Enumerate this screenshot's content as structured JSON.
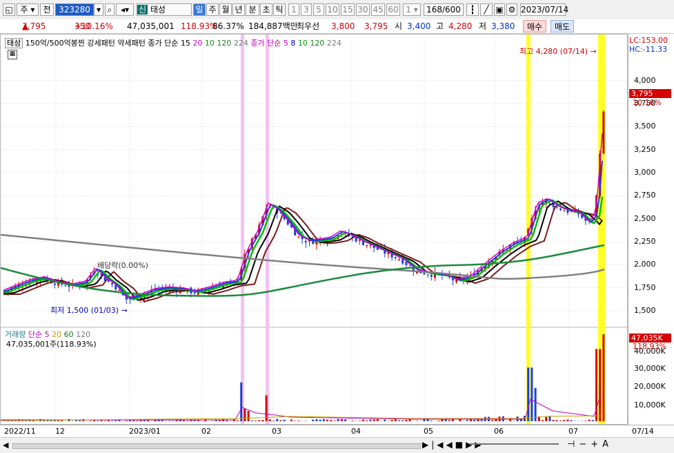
{
  "toolbar": {
    "market": "주",
    "prev_label": "전",
    "code": "323280",
    "stock_name": "태성",
    "stock_badge": "신",
    "periods": [
      "일",
      "주",
      "월",
      "년",
      "분",
      "초",
      "틱"
    ],
    "selected_period": "일",
    "intervals": [
      "1",
      "3",
      "5",
      "10",
      "15",
      "30",
      "45",
      "60"
    ],
    "interval_input": "1",
    "count": "168",
    "count_total": "/600",
    "date": "2023/07/14"
  },
  "quote": {
    "price": "3,795",
    "change_arrow": "▲",
    "change": "350",
    "change_pct": "+10.16%",
    "volume": "47,035,001",
    "vol_ratio": "118.93%",
    "turnover": "86.37%",
    "amount": "184,887백만",
    "best_label": "최우선",
    "ask": "3,800",
    "bid": "3,795",
    "open_label": "시",
    "open": "3,400",
    "high_label": "고",
    "high": "4,280",
    "low_label": "저",
    "low": "3,380",
    "buy": "매수",
    "sell": "매도"
  },
  "chart_legend": {
    "name": "태성",
    "signals": "150억/500억봉찐  강세패턴  약세패턴",
    "ma_close_label": "종가 단순 15",
    "ma_close_periods": [
      "20",
      "10",
      "120",
      "224"
    ],
    "ma2_label": "종가 단순 5",
    "ma2_periods": [
      "8",
      "10",
      "120",
      "224"
    ]
  },
  "annotations": {
    "high_note": "최고 4,280 (07/14)",
    "low_note": "최저 1,500 (01/03)",
    "dividend": "배당락(0.00%)"
  },
  "price_axis": {
    "lc": "LC:153.00",
    "hc": "HC:-11.33",
    "ticks": [
      "4,000",
      "3,750",
      "3,500",
      "3,250",
      "3,000",
      "2,750",
      "2,500",
      "2,250",
      "2,000",
      "1,750",
      "1,500"
    ],
    "current": "3,795",
    "current_pct": "10.16%"
  },
  "volume_legend": {
    "label": "거래량",
    "ma_label": "단순",
    "ma_periods": [
      "5",
      "20",
      "60",
      "120"
    ],
    "value": "47,035,001주(118.93%)"
  },
  "volume_axis": {
    "ticks": [
      "40,000K",
      "30,000K",
      "20,000K",
      "10,000K"
    ],
    "current": "47,035K",
    "current_pct": "118.93%"
  },
  "x_axis": {
    "labels": [
      "2022/11",
      "12",
      "2023/01",
      "02",
      "03",
      "04",
      "05",
      "06",
      "07"
    ],
    "end_label": "07/14"
  },
  "colors": {
    "up": "#d40000",
    "down": "#1c3fd4",
    "highlight_pink": "#f0b8f0",
    "highlight_yellow": "#ffff00"
  },
  "chart_data": {
    "type": "candlestick",
    "yrange": [
      1350,
      4350
    ],
    "series_points": [
      [
        0,
        1700
      ],
      [
        20,
        1760
      ],
      [
        40,
        1820
      ],
      [
        60,
        1850
      ],
      [
        80,
        1800
      ],
      [
        100,
        1770
      ],
      [
        120,
        1800
      ],
      [
        135,
        1950
      ],
      [
        150,
        1840
      ],
      [
        165,
        1760
      ],
      [
        180,
        1620
      ],
      [
        200,
        1660
      ],
      [
        220,
        1720
      ],
      [
        240,
        1740
      ],
      [
        260,
        1730
      ],
      [
        280,
        1700
      ],
      [
        300,
        1740
      ],
      [
        320,
        1790
      ],
      [
        340,
        1810
      ],
      [
        355,
        2150
      ],
      [
        370,
        2350
      ],
      [
        385,
        2650
      ],
      [
        400,
        2580
      ],
      [
        415,
        2450
      ],
      [
        430,
        2300
      ],
      [
        445,
        2250
      ],
      [
        460,
        2260
      ],
      [
        475,
        2280
      ],
      [
        490,
        2350
      ],
      [
        505,
        2310
      ],
      [
        520,
        2250
      ],
      [
        535,
        2200
      ],
      [
        550,
        2150
      ],
      [
        565,
        2100
      ],
      [
        580,
        2050
      ],
      [
        600,
        1930
      ],
      [
        620,
        1900
      ],
      [
        640,
        1880
      ],
      [
        660,
        1820
      ],
      [
        680,
        1870
      ],
      [
        700,
        2000
      ],
      [
        720,
        2120
      ],
      [
        740,
        2220
      ],
      [
        760,
        2280
      ],
      [
        775,
        2650
      ],
      [
        790,
        2700
      ],
      [
        805,
        2620
      ],
      [
        820,
        2580
      ],
      [
        835,
        2560
      ],
      [
        850,
        2450
      ],
      [
        860,
        2550
      ],
      [
        870,
        3500
      ],
      [
        875,
        3795
      ]
    ]
  }
}
